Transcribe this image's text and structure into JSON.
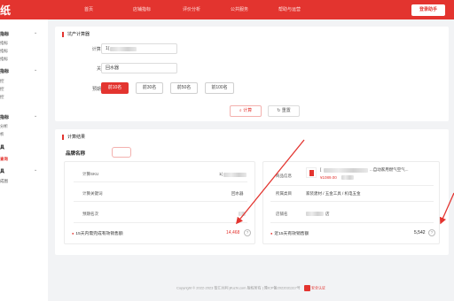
{
  "brand": {
    "logo_char": "纸"
  },
  "nav": {
    "items": [
      "首页",
      "店铺指标",
      "评价分析",
      "公共服务",
      "帮助与运营"
    ],
    "button_label": "登录助手"
  },
  "sidebar": {
    "groups": [
      {
        "label": "指标",
        "items": [
          "指标",
          "指标",
          "指标"
        ]
      },
      {
        "label": "指标",
        "items": [
          "控",
          "控",
          "控"
        ]
      },
      {
        "label": "指标",
        "items": [
          "分析",
          "析"
        ]
      },
      {
        "label": "具",
        "items": [
          "查询"
        ]
      },
      {
        "label": "具",
        "items": [
          "成图"
        ]
      }
    ],
    "active_item": "查询"
  },
  "form": {
    "title": "坑产计算器",
    "sku_label": "计算SKU",
    "sku_value": "1(",
    "keyword_label": "关键词",
    "keyword_value": "回水器",
    "rank_label": "预期名次",
    "rank_options": [
      "前10名",
      "前30名",
      "前50名",
      "前100名"
    ],
    "rank_selected": "前10名",
    "calc_label": "计算",
    "reset_label": "重置"
  },
  "results": {
    "title": "计算结果",
    "brand_label": "品牌名称",
    "left": {
      "sku_label": "计算SKU",
      "sku_value": "1(",
      "keyword_label": "计算关键词",
      "keyword_value": "回水器",
      "rank_label": "预期名次",
      "total_label": "15天内需完成有效销售额",
      "total_value": "14,468"
    },
    "right": {
      "product_label": "商品信息",
      "product_name": "[",
      "product_suffix": "...自动家用燃气空气...",
      "price": "¥1089.00",
      "category_label": "所属类目",
      "category_value": "家装建材 / 五金工具 / 机电五金",
      "shop_label": "店铺名",
      "shop_suffix": "店",
      "total_label": "近15天有效销售额",
      "total_value": "5,542"
    }
  },
  "footer": {
    "text": "Copyright © 2022-2023 智汇共利 jifuzhi.com 版权所有  |  豫ICP备2022031317号",
    "badge": "安全认证"
  }
}
